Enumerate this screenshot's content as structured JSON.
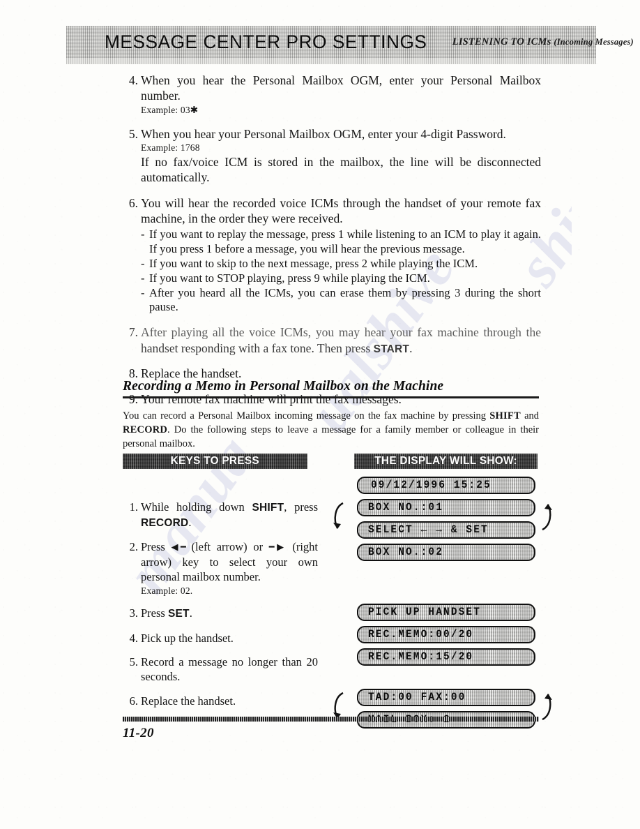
{
  "header": {
    "title": "MESSAGE CENTER PRO SETTINGS",
    "subtitle_main": "LISTENING TO ICMs",
    "subtitle_paren": "(Incoming Messages)"
  },
  "steps": [
    {
      "num": "4",
      "text": "When you hear the Personal Mailbox OGM, enter your Personal Mailbox number.",
      "example": "Example: 03✱"
    },
    {
      "num": "5",
      "text": "When you hear your Personal Mailbox OGM, enter your 4-digit Password.",
      "example": "Example: 1768",
      "text2": "If no fax/voice ICM is stored in the mailbox, the line will be disconnected automatically."
    },
    {
      "num": "6",
      "text": "You will hear the recorded voice ICMs through the handset of your remote fax machine, in the order they were received.",
      "sublist": [
        "If you want to replay the message, press 1 while listening to an ICM to play it again. If you press 1 before a message, you will hear the previous message.",
        "If you want to skip to the next message, press 2 while playing the ICM.",
        "If you want to STOP playing, press 9 while playing  the ICM.",
        "After you heard all the ICMs, you can erase them by pressing 3 during the short pause."
      ]
    },
    {
      "num": "7",
      "text_a": "After playing all the voice ICMs, you may hear your fax machine through the",
      "text_b": "handset responding with a fax tone. Then press ",
      "key": "START",
      "text_c": "."
    },
    {
      "num": "8",
      "text": "Replace the handset."
    },
    {
      "num": "9",
      "text": "Your remote fax machine will print the fax messages."
    }
  ],
  "section": {
    "heading": "Recording a Memo in Personal Mailbox on the Machine",
    "intro_a": "You can record a Personal Mailbox incoming message on the fax machine by pressing ",
    "intro_key1": "SHIFT",
    "intro_b": " and ",
    "intro_key2": "RECORD",
    "intro_c": ". Do the following steps to leave a message for a family member or colleague in their personal mailbox."
  },
  "columns": {
    "keys_banner": "KEYS TO PRESS",
    "display_banner": "THE DISPLAY WILL SHOW:"
  },
  "keys_steps": [
    {
      "num": "1",
      "pre": "While holding down ",
      "key1": "SHIFT",
      "mid": ", press ",
      "key2": "RECORD",
      "post": "."
    },
    {
      "num": "2",
      "pre": "Press ",
      "left_arrow": "◀━",
      "mid1": " (left arrow) or ",
      "right_arrow": "━▶",
      "mid2": " (right arrow) key to select your own personal mailbox number.",
      "example": "Example: 02."
    },
    {
      "num": "3",
      "pre": "Press ",
      "key1": "SET",
      "post": "."
    },
    {
      "num": "4",
      "pre": "Pick up the handset."
    },
    {
      "num": "5",
      "pre": "Record a message no longer than 20 seconds."
    },
    {
      "num": "6",
      "pre": "Replace the handset."
    }
  ],
  "display_groups": [
    {
      "loop": false,
      "lines": [
        "09/12/1996 15:25"
      ]
    },
    {
      "loop": true,
      "lines": [
        "BOX NO.:01",
        "SELECT ← → & SET"
      ]
    },
    {
      "loop": false,
      "lines": [
        "BOX NO.:02"
      ]
    },
    {
      "loop": false,
      "lines": [
        "PICK UP HANDSET",
        "REC.MEMO:00/20",
        "REC.MEMO:15/20"
      ]
    },
    {
      "loop": true,
      "lines": [
        "TAD:00 FAX:00",
        "MAIL BOX: 2"
      ]
    }
  ],
  "footer": {
    "page_number": "11-20"
  },
  "watermark": {
    "line1": "shing.com",
    "line2": "ualshive",
    "line3": "manua"
  },
  "colors": {
    "ink": "#151515",
    "banner_dark": "#3a3a3a",
    "header_band": "#d9d9d6",
    "lcd_face": "#cfcfcc",
    "watermark": "#747ac4"
  }
}
